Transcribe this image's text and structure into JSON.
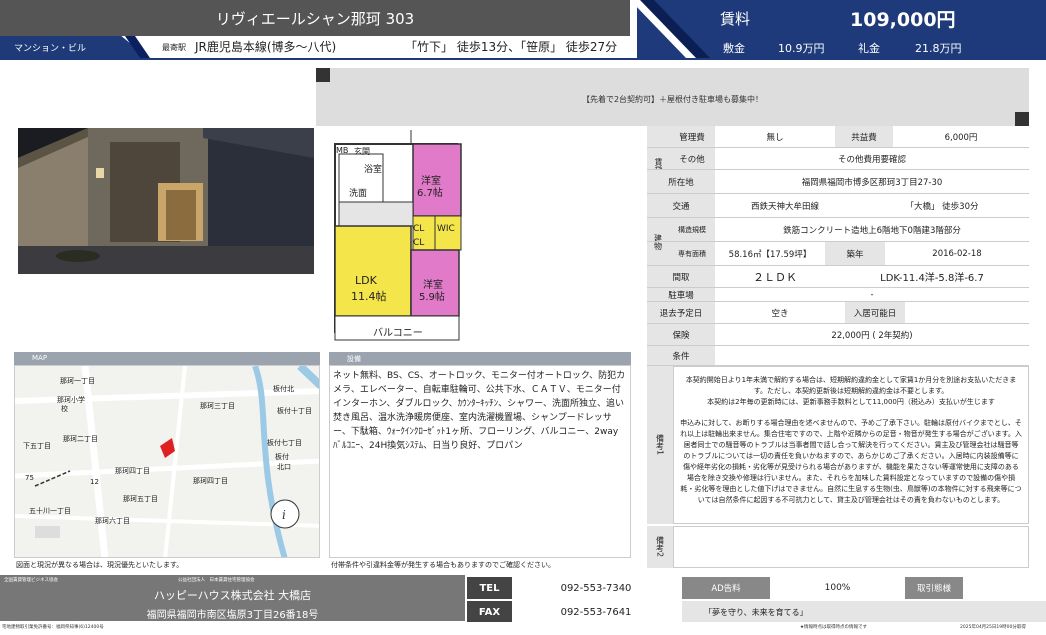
{
  "header": {
    "title": "リヴィエールシャン那珂 303",
    "building_type": "マンション・ビル",
    "station_label": "最寄駅",
    "line": "JR鹿児島本線(博多～八代)",
    "walk": "「竹下」 徒歩13分、「笹原」 徒歩27分",
    "rent_label": "賃料",
    "rent_value": "109,000円",
    "deposit_label": "敷金",
    "deposit_value": "10.9万円",
    "key_money_label": "礼金",
    "key_money_value": "21.8万円"
  },
  "banner": {
    "text": "【先着で2台契約可】＋屋根付き駐車場も募集中！"
  },
  "floorplan": {
    "rooms": [
      "MB",
      "玄関",
      "浴室",
      "洗面",
      "洋室",
      "6.7帖",
      "WIC",
      "CL",
      "CL",
      "LDK",
      "11.4帖",
      "洋室",
      "5.9帖",
      "バルコニー"
    ]
  },
  "table": {
    "side_label": "賃貸条件",
    "side_label2": "建物",
    "mgmt_label": "管理費",
    "mgmt_value": "無し",
    "common_label": "共益費",
    "common_value": "6,000円",
    "other_label": "その他",
    "other_value": "その他費用要確認",
    "address_label": "所在地",
    "address_value": "福岡県福岡市博多区那珂3丁目27-30",
    "transport_label": "交通",
    "transport_line": "西鉄天神大牟田線",
    "transport_walk": "「大橋」 徒歩30分",
    "structure_label": "構造規模",
    "structure_value": "鉄筋コンクリート造地上6階地下0階建3階部分",
    "area_label": "専有面積",
    "area_value": "58.16㎡【17.59坪】",
    "built_label": "築年",
    "built_value": "2016-02-18",
    "layout_label": "間取",
    "layout_value": "２ＬＤＫ",
    "layout_detail": "LDK-11.4洋-5.8洋-6.7",
    "parking_label": "駐車場",
    "parking_value": "-",
    "move_out_label": "退去予定日",
    "move_out_value": "空き",
    "move_in_label": "入居可能日",
    "move_in_value": "",
    "insurance_label": "保険",
    "insurance_value": "22,000円 ( 2年契約)",
    "conditions_label": "条件",
    "conditions_value": ""
  },
  "map": {
    "header": "MAP",
    "labels": [
      "那珂一丁目",
      "那珂小学",
      "校",
      "那珂二丁目",
      "下五丁目",
      "五十川一丁目",
      "那珂四丁目",
      "那珂五丁目",
      "那珂六丁目",
      "那珂三丁目",
      "板付北",
      "板付十丁目",
      "板付七丁目",
      "板付",
      "北口",
      "那珂四丁目",
      "75",
      "12"
    ]
  },
  "equipment": {
    "header": "設備",
    "text": "ネット無料、BS、CS、オートロック、モニター付オートロック、防犯カメラ、エレベーター、自転車駐輪可、公共下水、ＣＡＴＶ、モニター付インターホン、ダブルロック、ｶｳﾝﾀｰｷｯﾁﾝ、シャワー、洗面所独立、追い焚き風呂、温水洗浄暖房便座、室内洗濯機置場、シャンプードレッサー、下駄箱、ｳｫｰｸｲﾝｸﾛｰｾﾞｯﾄ1ヶ所、フローリング、バルコニー、2wayﾊﾞﾙｺﾆｰ、24H換気ｼｽﾃﾑ、日当り良好、プロパン"
  },
  "remarks": {
    "label1": "備考1",
    "text1a": "本契約開始日より1年未満で解約する場合は、短期解約違約金として家賃1か月分を別途お支払いただきます。ただし、本契約更新後は短期解約違約金は不要とします。",
    "text1b": "本契約は2年毎の更新時には、更新事務手数料として11,000円（税込み）支払いが生じます",
    "text1c": "申込みに対して、お断りする場合理由を述べませんので、予めご了承下さい。駐輪は原付バイクまでとし、それ以上は駐輪出来ません。集合住宅ですので、上階や近隣からの足音・物音が発生する場合がございます。入居者同士での騒音等のトラブルは当事者間で話し合って解決を行ってください。賃主及び管理会社は騒音等のトラブルについては一切の責任を負いかねますので、あらかじめご了承ください。入居時に内装設備等に傷や経年劣化の損耗・劣化等が見受けられる場合がありますが、機能を果たさない等運常使用に支障のある場合を除き交換や修理は行いません。また、それらを加味した賃料設定となっていますので設備の傷や損耗・劣化等を理由とした値下げはできません。自然に生息する生物(虫、鳥獣等)の本物件に対する飛来等については自然条件に起因する不可抗力として、貸主及び管理会社はその責を負わないものとします。",
    "label2": "備考2",
    "text2": ""
  },
  "notes": {
    "map_note": "図面と現況が異なる場合は、現況優先といたします。",
    "eq_note": "付帯条件や引違料金等が発生する場合もありますのでご確認ください。"
  },
  "footer": {
    "org1": "全国賃貸管理ビジネス協会",
    "org2": "公益社団法人　日本賃貸住宅管理協会",
    "company": "ハッピーハウス株式会社 大橋店",
    "address": "福岡県福岡市南区塩原3丁目26番18号",
    "tel_label": "TEL",
    "tel": "092-553-7340",
    "fax_label": "FAX",
    "fax": "092-553-7641",
    "ad_label": "AD告料",
    "ad_value": "100%",
    "deal_label": "取引態様",
    "deal_value": "",
    "slogan": "「夢を守り、未来を育てる」",
    "license": "宅地建物取引業免許番号：福岡県知事(6)12400号",
    "small_note": "★情報時点は取得時点の情報です",
    "date_note": "2025年04月25日19時00分取得"
  }
}
